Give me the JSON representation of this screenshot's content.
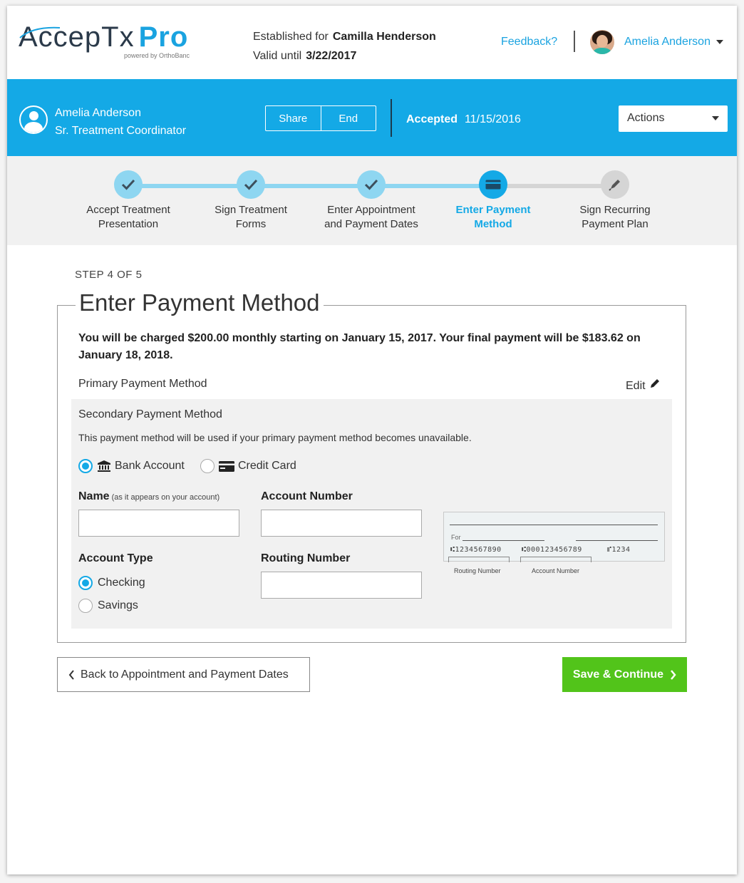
{
  "header": {
    "logo_main": "AccepTx",
    "logo_pro": "Pro",
    "logo_sub": "powered by OrthoBanc",
    "established_label": "Established for",
    "established_name": "Camilla Henderson",
    "valid_label": "Valid until",
    "valid_date": "3/22/2017",
    "feedback": "Feedback?",
    "user_name": "Amelia Anderson"
  },
  "bar": {
    "name": "Amelia Anderson",
    "role": "Sr. Treatment Coordinator",
    "share": "Share",
    "end": "End",
    "status_label": "Accepted",
    "status_date": "11/15/2016",
    "actions": "Actions"
  },
  "steps": [
    {
      "line1": "Accept Treatment",
      "line2": "Presentation",
      "state": "done"
    },
    {
      "line1": "Sign Treatment",
      "line2": "Forms",
      "state": "done"
    },
    {
      "line1": "Enter Appointment",
      "line2": "and Payment Dates",
      "state": "done"
    },
    {
      "line1": "Enter Payment",
      "line2": "Method",
      "state": "active"
    },
    {
      "line1": "Sign Recurring",
      "line2": "Payment Plan",
      "state": "todo"
    }
  ],
  "content": {
    "step_indicator": "STEP 4 OF 5",
    "title": "Enter Payment Method",
    "notice": "You will be charged $200.00 monthly starting on January 15, 2017. Your final payment will be $183.62 on January 18, 2018.",
    "primary_label": "Primary Payment Method",
    "edit": "Edit",
    "secondary": {
      "title": "Secondary Payment Method",
      "description": "This payment method will be used if your primary payment method becomes unavailable.",
      "bank_account": "Bank Account",
      "credit_card": "Credit Card",
      "name_label": "Name",
      "name_hint": "(as it appears on your account)",
      "name_value": "",
      "account_number_label": "Account Number",
      "account_number_value": "",
      "account_type_label": "Account Type",
      "checking": "Checking",
      "savings": "Savings",
      "routing_number_label": "Routing Number",
      "routing_number_value": "",
      "check_for": "For",
      "check_micr_routing": "⑆1234567890",
      "check_micr_account": "⑆000123456789",
      "check_micr_number": "⑈1234",
      "check_routing_caption": "Routing Number",
      "check_account_caption": "Account Number"
    }
  },
  "footer": {
    "back": "Back to Appointment and Payment Dates",
    "save": "Save & Continue"
  },
  "colors": {
    "accent": "#14a9e6",
    "step_done": "#8ed6f1",
    "save": "#52c41a"
  }
}
